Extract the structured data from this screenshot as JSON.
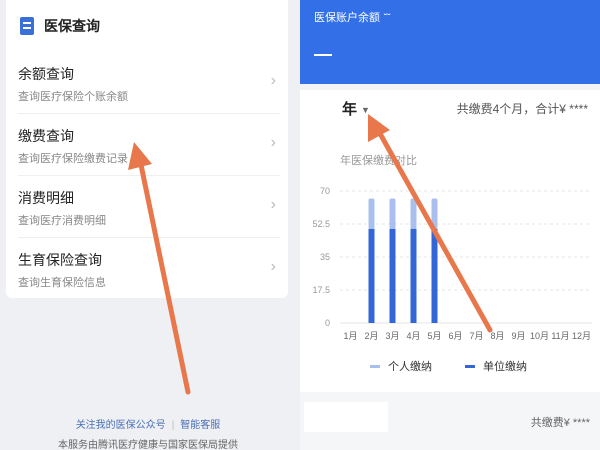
{
  "left": {
    "card_title": "医保查询",
    "items": [
      {
        "title": "余额查询",
        "subtitle": "查询医疗保险个账余额"
      },
      {
        "title": "缴费查询",
        "subtitle": "查询医疗保险缴费记录"
      },
      {
        "title": "消费明细",
        "subtitle": "查询医疗消费明细"
      },
      {
        "title": "生育保险查询",
        "subtitle": "查询生育保险信息"
      }
    ],
    "footer": {
      "link1": "关注我的医保公众号",
      "separator": "|",
      "link2": "智能客服",
      "note": "本服务由腾讯医疗健康与国家医保局提供"
    }
  },
  "right": {
    "header_title": "医保账户余额",
    "year_label": "年",
    "summary": "共缴费4个月，合计¥ ****",
    "chart_title": "年医保缴费对比",
    "bottom_text": "共缴费¥ ****"
  },
  "colors": {
    "primary": "#3370e8",
    "personal": "#a9c0ee",
    "employer": "#3366d6",
    "arrow": "#e8774b"
  },
  "chart_data": {
    "type": "bar",
    "title": "年医保缴费对比",
    "categories": [
      "1月",
      "2月",
      "3月",
      "4月",
      "5月",
      "6月",
      "7月",
      "8月",
      "9月",
      "10月",
      "11月",
      "12月"
    ],
    "series": [
      {
        "name": "单位缴纳",
        "values": [
          0,
          50,
          50,
          50,
          50,
          0,
          0,
          0,
          0,
          0,
          0,
          0
        ]
      },
      {
        "name": "个人缴纳",
        "values": [
          0,
          16,
          16,
          16,
          16,
          0,
          0,
          0,
          0,
          0,
          0,
          0
        ]
      }
    ],
    "stacked": true,
    "yticks": [
      "70",
      "52.5",
      "35",
      "17.5",
      "0"
    ],
    "ytick_values": [
      70,
      52.5,
      35,
      17.5,
      0
    ],
    "ylim": [
      0,
      70
    ],
    "legend_position": "bottom"
  }
}
